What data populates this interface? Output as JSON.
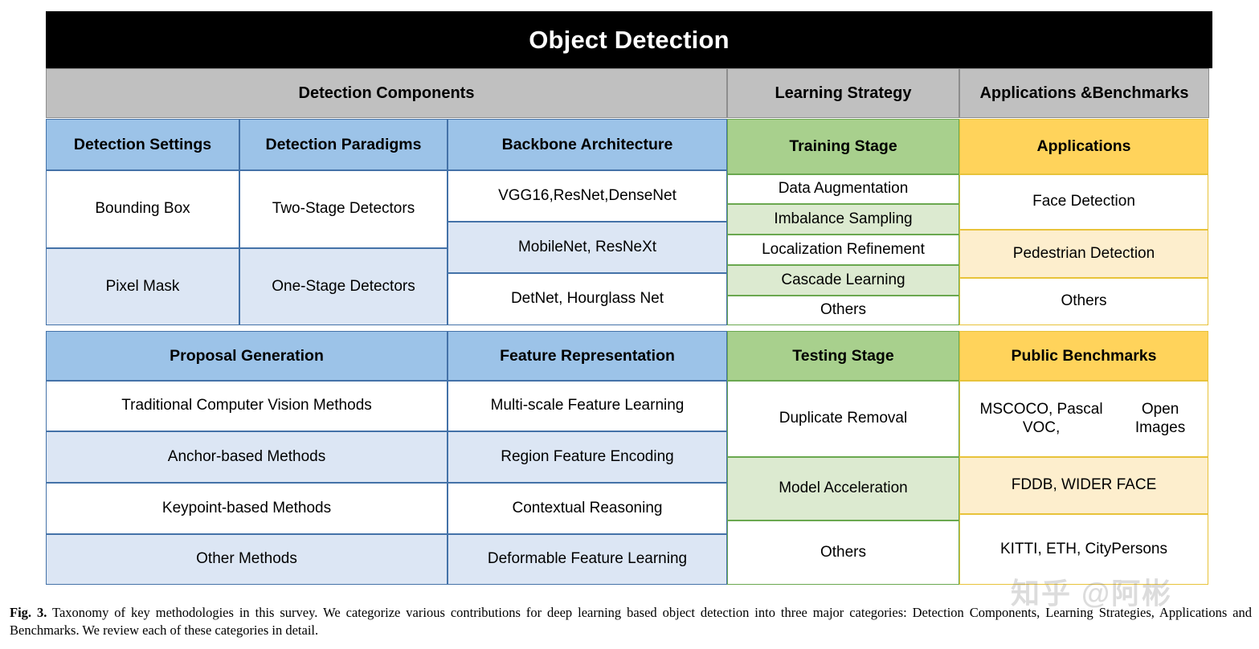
{
  "figure": {
    "title": "Object Detection",
    "caption_label": "Fig. 3.",
    "caption_text": "Taxonomy of key methodologies in this survey. We categorize various contributions for deep learning based object detection into three major categories: Detection Components, Learning Strategies, Applications and Benchmarks. We review each of these categories in detail.",
    "watermark": "知乎 @阿彬"
  },
  "colors": {
    "title_bg": "#000000",
    "title_fg": "#ffffff",
    "category_bg": "#c0c0c0",
    "blue_header": "#9cc3e8",
    "blue_tint": "#dce6f4",
    "blue_border": "#4472a8",
    "green_header": "#a8d08d",
    "green_tint": "#dcead0",
    "green_border": "#6aa84f",
    "orange_header": "#ffd35b",
    "orange_tint": "#fdeecd",
    "orange_border": "#e8c33a"
  },
  "categories": {
    "detection_components": "Detection Components",
    "learning_strategy": "Learning Strategy",
    "applications_benchmarks": "Applications &\nBenchmarks",
    "applications_benchmarks_line1": "Applications &",
    "applications_benchmarks_line2": "Benchmarks"
  },
  "groups": {
    "detection_settings": {
      "title": "Detection Settings",
      "items": [
        "Bounding Box",
        "Pixel Mask"
      ]
    },
    "detection_paradigms": {
      "title": "Detection Paradigms",
      "items": [
        "Two-Stage Detectors",
        "One-Stage Detectors"
      ]
    },
    "backbone_architecture": {
      "title": "Backbone Architecture",
      "items": [
        "VGG16,ResNet,DenseNet",
        "MobileNet, ResNeXt",
        "DetNet, Hourglass Net"
      ]
    },
    "proposal_generation": {
      "title": "Proposal Generation",
      "items": [
        "Traditional Computer Vision Methods",
        "Anchor-based Methods",
        "Keypoint-based Methods",
        "Other Methods"
      ]
    },
    "feature_representation": {
      "title": "Feature Representation",
      "items": [
        "Multi-scale Feature Learning",
        "Region Feature Encoding",
        "Contextual Reasoning",
        "Deformable Feature Learning"
      ]
    },
    "training_stage": {
      "title": "Training Stage",
      "items": [
        "Data Augmentation",
        "Imbalance Sampling",
        "Localization Refinement",
        "Cascade Learning",
        "Others"
      ]
    },
    "testing_stage": {
      "title": "Testing Stage",
      "items": [
        "Duplicate Removal",
        "Model Acceleration",
        "Others"
      ]
    },
    "applications": {
      "title": "Applications",
      "items": [
        "Face Detection",
        "Pedestrian Detection",
        "Others"
      ]
    },
    "public_benchmarks": {
      "title": "Public Benchmarks",
      "items": [
        "MSCOCO, Pascal VOC, Open Images",
        "FDDB, WIDER FACE",
        "KITTI, ETH, CityPersons"
      ],
      "items_lines": {
        "0_line1": "MSCOCO, Pascal VOC,",
        "0_line2": "Open Images"
      }
    }
  }
}
